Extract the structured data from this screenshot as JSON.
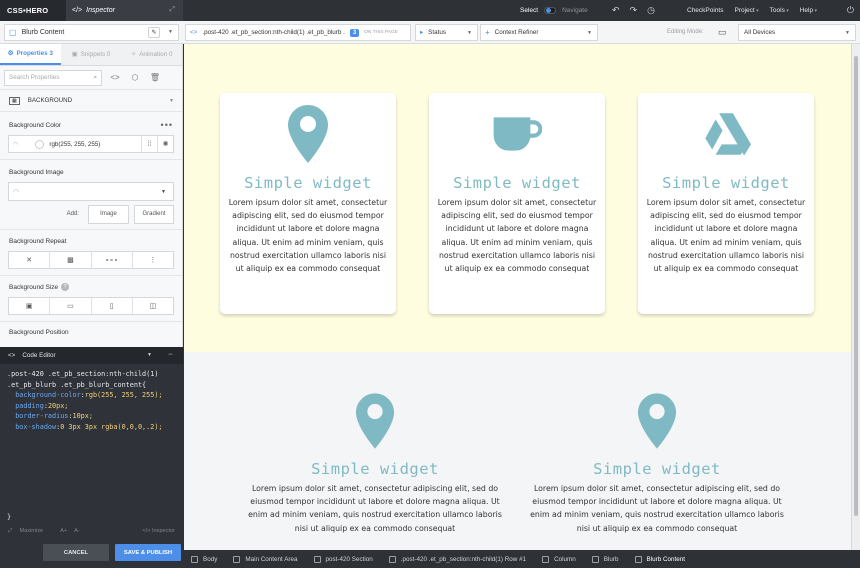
{
  "topbar": {
    "logo": "CSS•HERO",
    "inspector_tab": "Inspector",
    "select_label": "Select",
    "navigate_label": "Navigate",
    "menu": [
      "CheckPoints",
      "Project",
      "Tools",
      "Help"
    ]
  },
  "secondbar": {
    "selector": "Blurb Content",
    "crumb": ".post-420 .et_pb_section:nth-child(1) .et_pb_blurb .",
    "count": "3",
    "count_note": "ON THIS PAGE",
    "status": "Status",
    "context_refiner": "Context Refiner",
    "editing_mode_label": "Editing Mode:",
    "device": "All Devices"
  },
  "panel": {
    "tabs": [
      {
        "label": "Properties 3",
        "active": true
      },
      {
        "label": "Snippets 0",
        "active": false
      },
      {
        "label": "Animation 0",
        "active": false
      }
    ],
    "search_placeholder": "Search Properties",
    "group": "BACKGROUND",
    "bg_color_label": "Background Color",
    "bg_color_value": "rgb(255, 255, 255)",
    "bg_image_label": "Background Image",
    "add_label": "Add:",
    "image_btn": "Image",
    "gradient_btn": "Gradient",
    "bg_repeat_label": "Background Repeat",
    "bg_size_label": "Background Size",
    "bg_position_label": "Background Position"
  },
  "code_editor": {
    "title": "Code Editor",
    "selector_line1": ".post-420 .et_pb_section:nth-child(1)",
    "selector_line2": ".et_pb_blurb .et_pb_blurb_content{",
    "props": [
      {
        "k": "background-color",
        "v": "rgb(255, 255, 255);"
      },
      {
        "k": "padding",
        "v": "20px;"
      },
      {
        "k": "border-radius",
        "v": "10px;"
      },
      {
        "k": "box-shadow",
        "v": "0 3px 3px rgba(0,0,0,.2);"
      }
    ],
    "close_brace": "}",
    "maximize": "Maximize",
    "font_up": "A+",
    "font_down": "A-",
    "inspector": "Inspector",
    "cancel": "CANCEL",
    "save": "SAVE & PUBLISH"
  },
  "preview": {
    "widget_title": "Simple widget",
    "card_text": "Lorem ipsum dolor sit amet, consectetur adipiscing elit, sed do eiusmod tempor incididunt ut labore et dolore magna aliqua. Ut enim ad minim veniam, quis nostrud exercitation ullamco laboris nisi ut aliquip ex ea commodo consequat",
    "wide_text": "Lorem ipsum dolor sit amet, consectetur adipiscing elit, sed do eiusmod tempor incididunt ut labore et dolore magna aliqua. Ut enim ad minim veniam, quis nostrud exercitation ullamco laboris nisi ut aliquip ex ea commodo consequat",
    "icons": [
      "map-pin-icon",
      "coffee-cup-icon",
      "drive-triangle-icon",
      "map-pin-icon",
      "map-pin-icon"
    ],
    "icon_color": "#7fbac4",
    "section1_bg": "#fffde0",
    "section2_bg": "#f4f5f6"
  },
  "bottombar": {
    "crumbs": [
      "Body",
      "Main Content Area",
      "post-420 Section",
      ".post-420 .et_pb_section:nth-child(1) Row #1",
      "Column",
      "Blurb",
      "Blurb Content"
    ]
  },
  "colors": {
    "accent": "#4d8fe8",
    "dark": "#2f3238"
  }
}
